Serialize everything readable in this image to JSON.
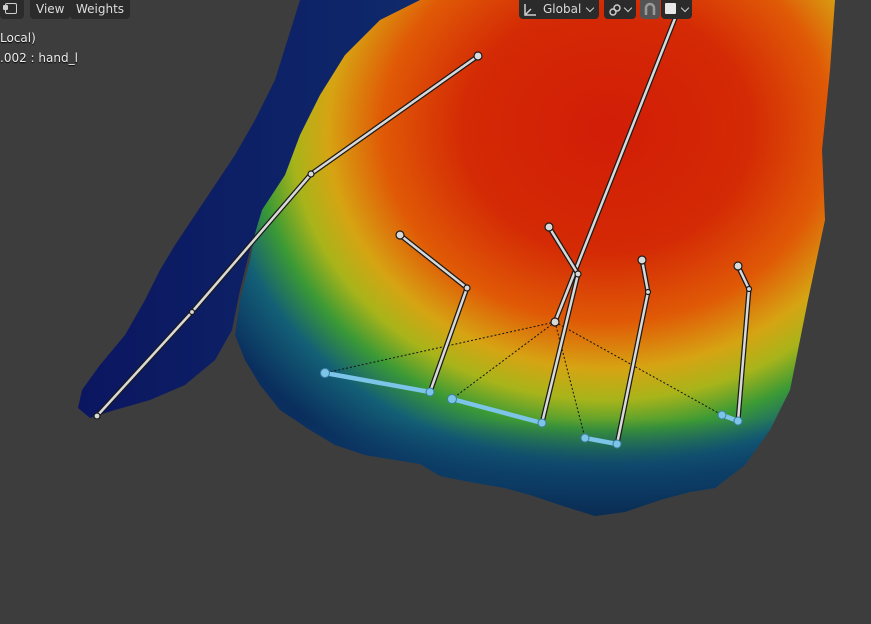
{
  "header": {
    "menu": [
      {
        "label": "View"
      },
      {
        "label": "Weights"
      }
    ],
    "transform_orientation": "Global",
    "editor_icon": "editor-type-icon",
    "pivot_icon": "pivot-point-icon",
    "snap_icon": "snap-magnet-icon",
    "shading_icon": "solid-shading-icon"
  },
  "overlay": {
    "line1": "Local)",
    "line2": ".002 : hand_l"
  },
  "colors": {
    "background": "#3d3d3d",
    "selected_bone": "#7cc4e8",
    "bone_outline": "#1a1a1a",
    "bone_fill": "#d9d9d9"
  }
}
